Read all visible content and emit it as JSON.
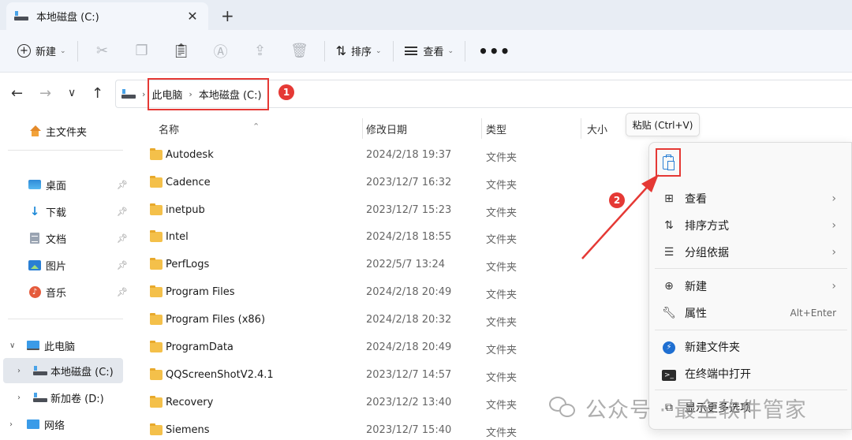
{
  "tab": {
    "title": "本地磁盘 (C:)",
    "close": "✕",
    "new_tab": "+"
  },
  "toolbar": {
    "new_label": "新建",
    "sort_label": "排序",
    "view_label": "查看",
    "more": "•••"
  },
  "nav": {
    "back": "←",
    "forward": "→",
    "recent": "∨",
    "up": "↑"
  },
  "breadcrumb": {
    "items": [
      "此电脑",
      "本地磁盘 (C:)"
    ]
  },
  "annotations": {
    "badge1": "1",
    "badge2": "2",
    "color": "#e53935"
  },
  "sidebar": {
    "home": "主文件夹",
    "quick": [
      {
        "label": "桌面",
        "icon": "desktop-icon"
      },
      {
        "label": "下载",
        "icon": "download-icon"
      },
      {
        "label": "文档",
        "icon": "document-icon"
      },
      {
        "label": "图片",
        "icon": "pictures-icon"
      },
      {
        "label": "音乐",
        "icon": "music-icon"
      }
    ],
    "this_pc": "此电脑",
    "drive_c": "本地磁盘 (C:)",
    "drive_d": "新加卷 (D:)",
    "network": "网络"
  },
  "columns": {
    "name": "名称",
    "modified": "修改日期",
    "type": "类型",
    "size": "大小"
  },
  "files": [
    {
      "name": "Autodesk",
      "date": "2024/2/18 19:37",
      "type": "文件夹"
    },
    {
      "name": "Cadence",
      "date": "2023/12/7 16:32",
      "type": "文件夹"
    },
    {
      "name": "inetpub",
      "date": "2023/12/7 15:23",
      "type": "文件夹"
    },
    {
      "name": "Intel",
      "date": "2024/2/18 18:55",
      "type": "文件夹"
    },
    {
      "name": "PerfLogs",
      "date": "2022/5/7 13:24",
      "type": "文件夹"
    },
    {
      "name": "Program Files",
      "date": "2024/2/18 20:49",
      "type": "文件夹"
    },
    {
      "name": "Program Files (x86)",
      "date": "2024/2/18 20:32",
      "type": "文件夹"
    },
    {
      "name": "ProgramData",
      "date": "2024/2/18 20:49",
      "type": "文件夹"
    },
    {
      "name": "QQScreenShotV2.4.1",
      "date": "2023/12/7 14:57",
      "type": "文件夹"
    },
    {
      "name": "Recovery",
      "date": "2023/12/2 13:40",
      "type": "文件夹"
    },
    {
      "name": "Siemens",
      "date": "2023/12/7 15:40",
      "type": "文件夹"
    }
  ],
  "tooltip": "粘贴 (Ctrl+V)",
  "context_menu": {
    "view": "查看",
    "sort_by": "排序方式",
    "group_by": "分组依据",
    "new": "新建",
    "properties": "属性",
    "properties_shortcut": "Alt+Enter",
    "new_folder": "新建文件夹",
    "open_terminal": "在终端中打开",
    "show_more": "显示更多选项"
  },
  "watermark": "公众号 · 最全软件管家"
}
